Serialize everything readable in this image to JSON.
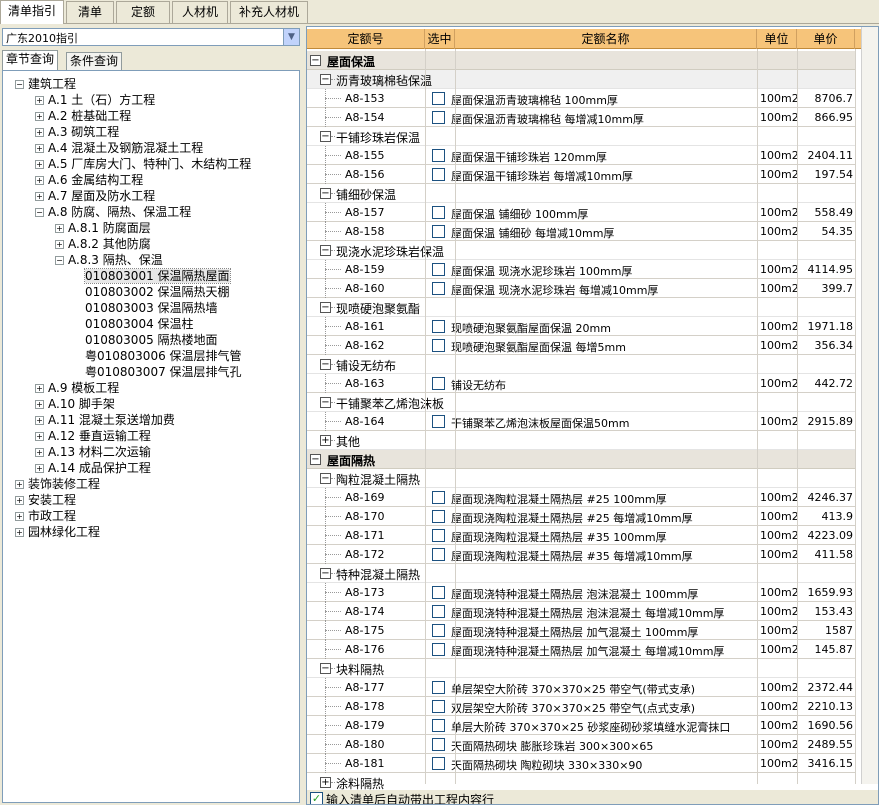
{
  "top_tabs": [
    "清单指引",
    "清单",
    "定额",
    "人材机",
    "补充人材机"
  ],
  "guide_select": "广东2010指引",
  "sub_tabs": [
    "章节查询",
    "条件查询"
  ],
  "tree": [
    {
      "label": "建筑工程",
      "sign": "−"
    },
    {
      "label": "A.1 土（石）方工程",
      "sign": "+"
    },
    {
      "label": "A.2 桩基础工程",
      "sign": "+"
    },
    {
      "label": "A.3 砌筑工程",
      "sign": "+"
    },
    {
      "label": "A.4 混凝土及钢筋混凝土工程",
      "sign": "+"
    },
    {
      "label": "A.5 厂库房大门、特种门、木结构工程",
      "sign": "+"
    },
    {
      "label": "A.6 金属结构工程",
      "sign": "+"
    },
    {
      "label": "A.7 屋面及防水工程",
      "sign": "+"
    },
    {
      "label": "A.8 防腐、隔热、保温工程",
      "sign": "−"
    },
    {
      "label": "A.8.1 防腐面层",
      "sign": "+"
    },
    {
      "label": "A.8.2 其他防腐",
      "sign": "+"
    },
    {
      "label": "A.8.3 隔热、保温",
      "sign": "−"
    },
    {
      "label": "010803001  保温隔热屋面",
      "sign": ""
    },
    {
      "label": "010803002  保温隔热天棚",
      "sign": ""
    },
    {
      "label": "010803003  保温隔热墙",
      "sign": ""
    },
    {
      "label": "010803004  保温柱",
      "sign": ""
    },
    {
      "label": "010803005  隔热楼地面",
      "sign": ""
    },
    {
      "label": "粤010803006  保温层排气管",
      "sign": ""
    },
    {
      "label": "粤010803007  保温层排气孔",
      "sign": ""
    },
    {
      "label": "A.9 模板工程",
      "sign": "+"
    },
    {
      "label": "A.10 脚手架",
      "sign": "+"
    },
    {
      "label": "A.11 混凝土泵送增加费",
      "sign": "+"
    },
    {
      "label": "A.12 垂直运输工程",
      "sign": "+"
    },
    {
      "label": "A.13 材料二次运输",
      "sign": "+"
    },
    {
      "label": "A.14 成品保护工程",
      "sign": "+"
    },
    {
      "label": "装饰装修工程",
      "sign": "+"
    },
    {
      "label": "安装工程",
      "sign": "+"
    },
    {
      "label": "市政工程",
      "sign": "+"
    },
    {
      "label": "园林绿化工程",
      "sign": "+"
    }
  ],
  "headers": {
    "code": "定额号",
    "select": "选中",
    "name": "定额名称",
    "unit": "单位",
    "price": "单价"
  },
  "rows": [
    {
      "t": "g",
      "label": "屋面保温",
      "sign": "−"
    },
    {
      "t": "s",
      "label": "沥青玻璃棉毡保温",
      "sign": "−"
    },
    {
      "t": "r",
      "code": "A8-153",
      "name": "屋面保温沥青玻璃棉毡 100mm厚",
      "unit": "100m2",
      "price": "8706.7"
    },
    {
      "t": "r",
      "code": "A8-154",
      "name": "屋面保温沥青玻璃棉毡 每增减10mm厚",
      "unit": "100m2",
      "price": "866.95"
    },
    {
      "t": "s",
      "label": "干铺珍珠岩保温",
      "sign": "−"
    },
    {
      "t": "r",
      "code": "A8-155",
      "name": "屋面保温干铺珍珠岩 120mm厚",
      "unit": "100m2",
      "price": "2404.11"
    },
    {
      "t": "r",
      "code": "A8-156",
      "name": "屋面保温干铺珍珠岩 每增减10mm厚",
      "unit": "100m2",
      "price": "197.54"
    },
    {
      "t": "s",
      "label": "铺细砂保温",
      "sign": "−"
    },
    {
      "t": "r",
      "code": "A8-157",
      "name": "屋面保温 铺细砂 100mm厚",
      "unit": "100m2",
      "price": "558.49"
    },
    {
      "t": "r",
      "code": "A8-158",
      "name": "屋面保温 铺细砂 每增减10mm厚",
      "unit": "100m2",
      "price": "54.35"
    },
    {
      "t": "s",
      "label": "现浇水泥珍珠岩保温",
      "sign": "−"
    },
    {
      "t": "r",
      "code": "A8-159",
      "name": "屋面保温 现浇水泥珍珠岩 100mm厚",
      "unit": "100m2",
      "price": "4114.95"
    },
    {
      "t": "r",
      "code": "A8-160",
      "name": "屋面保温 现浇水泥珍珠岩 每增减10mm厚",
      "unit": "100m2",
      "price": "399.7"
    },
    {
      "t": "s",
      "label": "现喷硬泡聚氨酯",
      "sign": "−"
    },
    {
      "t": "r",
      "code": "A8-161",
      "name": "现喷硬泡聚氨酯屋面保温 20mm",
      "unit": "100m2",
      "price": "1971.18"
    },
    {
      "t": "r",
      "code": "A8-162",
      "name": "现喷硬泡聚氨酯屋面保温 每增5mm",
      "unit": "100m2",
      "price": "356.34"
    },
    {
      "t": "s",
      "label": "铺设无纺布",
      "sign": "−"
    },
    {
      "t": "r",
      "code": "A8-163",
      "name": "铺设无纺布",
      "unit": "100m2",
      "price": "442.72"
    },
    {
      "t": "s",
      "label": "干铺聚苯乙烯泡沫板",
      "sign": "−"
    },
    {
      "t": "r",
      "code": "A8-164",
      "name": "干铺聚苯乙烯泡沫板屋面保温50mm",
      "unit": "100m2",
      "price": "2915.89"
    },
    {
      "t": "s",
      "label": "其他",
      "sign": "+"
    },
    {
      "t": "g",
      "label": "屋面隔热",
      "sign": "−"
    },
    {
      "t": "s",
      "label": "陶粒混凝土隔热",
      "sign": "−"
    },
    {
      "t": "r",
      "code": "A8-169",
      "name": "屋面现浇陶粒混凝土隔热层 #25 100mm厚",
      "unit": "100m2",
      "price": "4246.37"
    },
    {
      "t": "r",
      "code": "A8-170",
      "name": "屋面现浇陶粒混凝土隔热层 #25 每增减10mm厚",
      "unit": "100m2",
      "price": "413.9"
    },
    {
      "t": "r",
      "code": "A8-171",
      "name": "屋面现浇陶粒混凝土隔热层 #35 100mm厚",
      "unit": "100m2",
      "price": "4223.09"
    },
    {
      "t": "r",
      "code": "A8-172",
      "name": "屋面现浇陶粒混凝土隔热层 #35 每增减10mm厚",
      "unit": "100m2",
      "price": "411.58"
    },
    {
      "t": "s",
      "label": "特种混凝土隔热",
      "sign": "−"
    },
    {
      "t": "r",
      "code": "A8-173",
      "name": "屋面现浇特种混凝土隔热层 泡沫混凝土 100mm厚",
      "unit": "100m2",
      "price": "1659.93"
    },
    {
      "t": "r",
      "code": "A8-174",
      "name": "屋面现浇特种混凝土隔热层 泡沫混凝土 每增减10mm厚",
      "unit": "100m2",
      "price": "153.43"
    },
    {
      "t": "r",
      "code": "A8-175",
      "name": "屋面现浇特种混凝土隔热层 加气混凝土 100mm厚",
      "unit": "100m2",
      "price": "1587"
    },
    {
      "t": "r",
      "code": "A8-176",
      "name": "屋面现浇特种混凝土隔热层 加气混凝土 每增减10mm厚",
      "unit": "100m2",
      "price": "145.87"
    },
    {
      "t": "s",
      "label": "块料隔热",
      "sign": "−"
    },
    {
      "t": "r",
      "code": "A8-177",
      "name": "单层架空大阶砖 370×370×25 带空气(带式支承)",
      "unit": "100m2",
      "price": "2372.44"
    },
    {
      "t": "r",
      "code": "A8-178",
      "name": "双层架空大阶砖 370×370×25 带空气(点式支承)",
      "unit": "100m2",
      "price": "2210.13"
    },
    {
      "t": "r",
      "code": "A8-179",
      "name": "单层大阶砖 370×370×25 砂浆座砌砂浆填缝水泥膏抹口",
      "unit": "100m2",
      "price": "1690.56"
    },
    {
      "t": "r",
      "code": "A8-180",
      "name": "天面隔热砌块 膨胀珍珠岩 300×300×65",
      "unit": "100m2",
      "price": "2489.55"
    },
    {
      "t": "r",
      "code": "A8-181",
      "name": "天面隔热砌块 陶粒砌块 330×330×90",
      "unit": "100m2",
      "price": "3416.15"
    },
    {
      "t": "s",
      "label": "涂料隔热",
      "sign": "+"
    }
  ],
  "bottom_check": {
    "label": "输入清单后自动带出工程内容行",
    "checked": "✓"
  }
}
